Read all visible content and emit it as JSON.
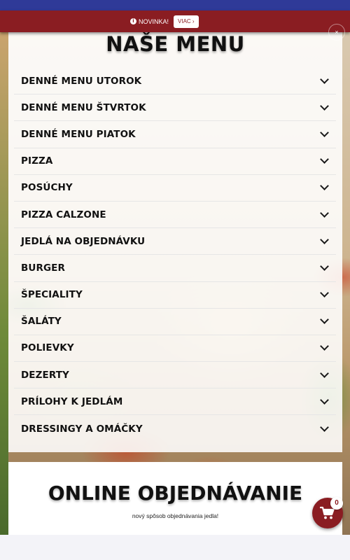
{
  "notice": {
    "text": "NOVINKA!",
    "more_label": "VIAC",
    "close_label": "×"
  },
  "menu": {
    "title": "NAŠE MENU",
    "items": [
      {
        "label": "DENNÉ MENU UTOROK"
      },
      {
        "label": "DENNÉ MENU ŠTVRTOK"
      },
      {
        "label": "DENNÉ MENU PIATOK"
      },
      {
        "label": "PIZZA"
      },
      {
        "label": "POSÚCHY"
      },
      {
        "label": "PIZZA CALZONE"
      },
      {
        "label": "JEDLÁ NA OBJEDNÁVKU"
      },
      {
        "label": "BURGER"
      },
      {
        "label": "ŠPECIALITY"
      },
      {
        "label": "ŠALÁTY"
      },
      {
        "label": "POLIEVKY"
      },
      {
        "label": "DEZERTY"
      },
      {
        "label": "PRÍLOHY K JEDLÁM"
      },
      {
        "label": "DRESSINGY A OMÁČKY"
      }
    ]
  },
  "order": {
    "title": "ONLINE OBJEDNÁVANIE",
    "subtitle": "nový spôsob objednávania jedla!"
  },
  "cart": {
    "count": "0",
    "icon": "cart-icon"
  },
  "colors": {
    "top_bar": "#2f3a98",
    "brand_red": "#8a1d22"
  }
}
